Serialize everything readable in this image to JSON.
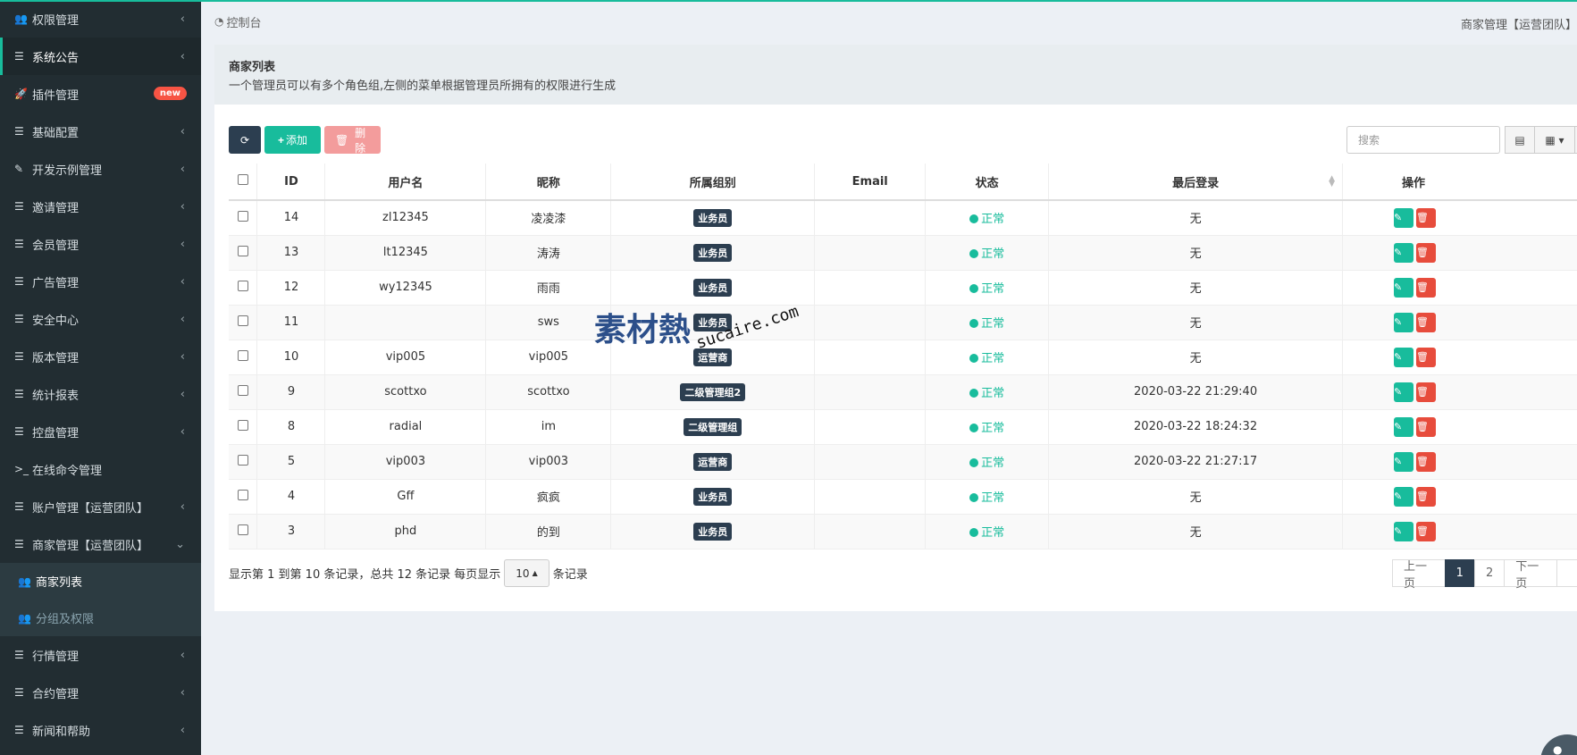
{
  "sidebar": {
    "items": [
      {
        "label": "权限管理",
        "icon": "users-icon",
        "glyph": "👥"
      },
      {
        "label": "系统公告",
        "icon": "list-icon",
        "glyph": "☰",
        "active": true
      },
      {
        "label": "插件管理",
        "icon": "rocket-icon",
        "glyph": "🚀",
        "badge": "new"
      },
      {
        "label": "基础配置",
        "icon": "list-icon",
        "glyph": "☰"
      },
      {
        "label": "开发示例管理",
        "icon": "magic-icon",
        "glyph": "✎"
      },
      {
        "label": "邀请管理",
        "icon": "list-icon",
        "glyph": "☰"
      },
      {
        "label": "会员管理",
        "icon": "list-icon",
        "glyph": "☰"
      },
      {
        "label": "广告管理",
        "icon": "list-icon",
        "glyph": "☰"
      },
      {
        "label": "安全中心",
        "icon": "list-icon",
        "glyph": "☰"
      },
      {
        "label": "版本管理",
        "icon": "list-icon",
        "glyph": "☰"
      },
      {
        "label": "统计报表",
        "icon": "list-icon",
        "glyph": "☰"
      },
      {
        "label": "控盘管理",
        "icon": "list-icon",
        "glyph": "☰"
      },
      {
        "label": "在线命令管理",
        "icon": "terminal-icon",
        "glyph": ">_"
      },
      {
        "label": "账户管理【运营团队】",
        "icon": "list-icon",
        "glyph": "☰"
      },
      {
        "label": "商家管理【运营团队】",
        "icon": "list-icon",
        "glyph": "☰",
        "expanded": true
      }
    ],
    "subitems": [
      {
        "label": "商家列表",
        "icon": "users-icon",
        "glyph": "👥"
      },
      {
        "label": "分组及权限",
        "icon": "users-icon",
        "glyph": "👥"
      }
    ],
    "items_after": [
      {
        "label": "行情管理",
        "icon": "list-icon",
        "glyph": "☰"
      },
      {
        "label": "合约管理",
        "icon": "list-icon",
        "glyph": "☰"
      },
      {
        "label": "新闻和帮助",
        "icon": "list-icon",
        "glyph": "☰"
      }
    ]
  },
  "breadcrumb": {
    "home": "控制台",
    "right": "商家管理【运营团队】"
  },
  "panel": {
    "title": "商家列表",
    "description": "一个管理员可以有多个角色组,左侧的菜单根据管理员所拥有的权限进行生成"
  },
  "toolbar": {
    "add_label": "添加",
    "delete_label": "删除",
    "search_placeholder": "搜索"
  },
  "table": {
    "headers": {
      "id": "ID",
      "username": "用户名",
      "nickname": "昵称",
      "group": "所属组别",
      "email": "Email",
      "status": "状态",
      "last_login": "最后登录",
      "ops": "操作"
    },
    "rows": [
      {
        "id": "14",
        "username": "zl12345",
        "nickname": "凌凌漆",
        "group": "业务员",
        "email": "",
        "status": "正常",
        "last_login": "无"
      },
      {
        "id": "13",
        "username": "lt12345",
        "nickname": "涛涛",
        "group": "业务员",
        "email": "",
        "status": "正常",
        "last_login": "无"
      },
      {
        "id": "12",
        "username": "wy12345",
        "nickname": "雨雨",
        "group": "业务员",
        "email": "",
        "status": "正常",
        "last_login": "无"
      },
      {
        "id": "11",
        "username": "",
        "nickname": "sws",
        "group": "业务员",
        "email": "",
        "status": "正常",
        "last_login": "无"
      },
      {
        "id": "10",
        "username": "vip005",
        "nickname": "vip005",
        "group": "运营商",
        "email": "",
        "status": "正常",
        "last_login": "无"
      },
      {
        "id": "9",
        "username": "scottxo",
        "nickname": "scottxo",
        "group": "二级管理组2",
        "email": "",
        "status": "正常",
        "last_login": "2020-03-22 21:29:40"
      },
      {
        "id": "8",
        "username": "radial",
        "nickname": "im",
        "group": "二级管理组",
        "email": "",
        "status": "正常",
        "last_login": "2020-03-22 18:24:32"
      },
      {
        "id": "5",
        "username": "vip003",
        "nickname": "vip003",
        "group": "运营商",
        "email": "",
        "status": "正常",
        "last_login": "2020-03-22 21:27:17"
      },
      {
        "id": "4",
        "username": "Gff",
        "nickname": "疯疯",
        "group": "业务员",
        "email": "",
        "status": "正常",
        "last_login": "无"
      },
      {
        "id": "3",
        "username": "phd",
        "nickname": "的到",
        "group": "业务员",
        "email": "",
        "status": "正常",
        "last_login": "无"
      }
    ]
  },
  "pager": {
    "summary": "显示第 1 到第 10 条记录，总共 12 条记录 每页显示",
    "page_size": "10",
    "suffix": "条记录",
    "prev": "上一页",
    "pages": [
      "1",
      "2"
    ],
    "next": "下一页"
  },
  "watermark": {
    "cn": "素材熱",
    "en": "sucaire.com"
  },
  "colors": {
    "accent": "#18bc9c",
    "sidebar": "#222d32",
    "danger": "#e74c3c",
    "primary": "#2c3e50"
  }
}
